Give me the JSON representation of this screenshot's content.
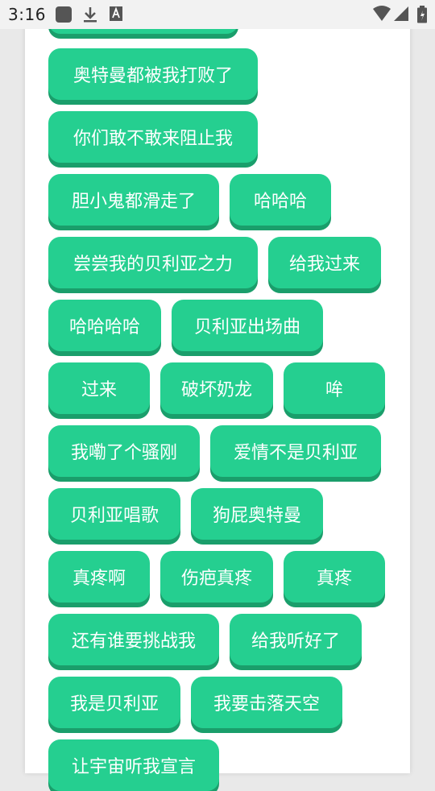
{
  "status_bar": {
    "time": "3:16",
    "left_icons": [
      "app-square-icon",
      "download-icon",
      "font-a-icon"
    ],
    "right_icons": [
      "wifi-icon",
      "signal-icon",
      "battery-icon"
    ]
  },
  "colors": {
    "button": "#25cf90",
    "button_shadow": "#1a9e6b",
    "panel": "#ffffff",
    "background": "#e9e9e9"
  },
  "sound_buttons": [
    "",
    "奥特曼都被我打败了",
    "你们敢不敢来阻止我",
    "胆小鬼都滑走了",
    "哈哈哈",
    "尝尝我的贝利亚之力",
    "给我过来",
    "哈哈哈哈",
    "贝利亚出场曲",
    "过来",
    "破坏奶龙",
    "哞",
    "我嘞了个骚刚",
    "爱情不是贝利亚",
    "贝利亚唱歌",
    "狗屁奥特曼",
    "真疼啊",
    "伤疤真疼",
    "真疼",
    "还有谁要挑战我",
    "给我听好了",
    "我是贝利亚",
    "我要击落天空",
    "让宇宙听我宣言"
  ]
}
